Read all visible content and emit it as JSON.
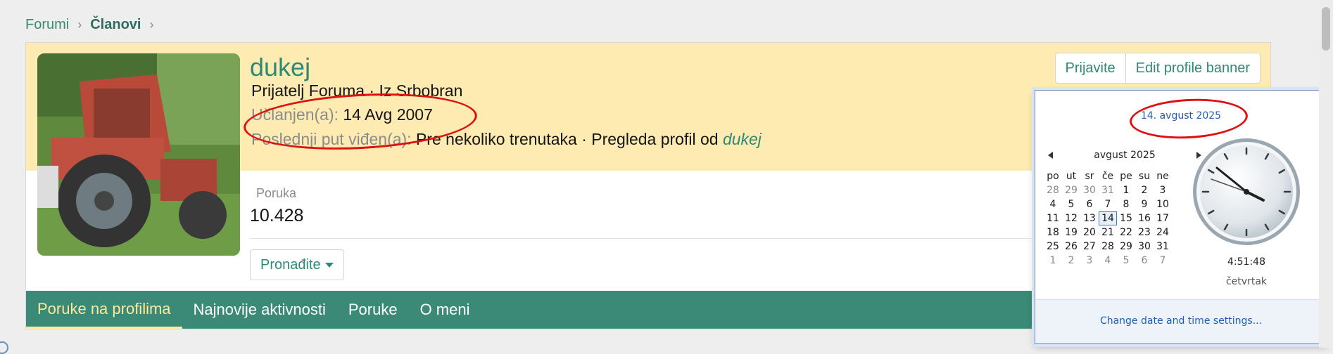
{
  "breadcrumb": {
    "item1": "Forumi",
    "item2": "Članovi"
  },
  "profile": {
    "username": "dukej",
    "title_line": "Prijatelj Foruma · Iz Srbobran",
    "joined_label": "Učlanjen(a):",
    "joined_value": "14 Avg 2007",
    "last_seen_label": "Poslednji put viđen(a):",
    "last_seen_value": "Pre nekoliko trenutaka · Pregleda profil od",
    "last_seen_user": "dukej",
    "stat_label": "Poruka",
    "stat_value": "10.428",
    "find_label": "Pronađite"
  },
  "buttons": {
    "report": "Prijavite",
    "edit_banner": "Edit profile banner"
  },
  "tabs": [
    "Poruke na profilima",
    "Najnovije aktivnosti",
    "Poruke",
    "O meni"
  ],
  "calendar": {
    "date_header": "14. avgust 2025",
    "month_label": "avgust 2025",
    "weekdays": [
      "po",
      "ut",
      "sr",
      "če",
      "pe",
      "su",
      "ne"
    ],
    "days": [
      [
        "28",
        "29",
        "30",
        "31",
        "1",
        "2",
        "3"
      ],
      [
        "4",
        "5",
        "6",
        "7",
        "8",
        "9",
        "10"
      ],
      [
        "11",
        "12",
        "13",
        "14",
        "15",
        "16",
        "17"
      ],
      [
        "18",
        "19",
        "20",
        "21",
        "22",
        "23",
        "24"
      ],
      [
        "25",
        "26",
        "27",
        "28",
        "29",
        "30",
        "31"
      ],
      [
        "1",
        "2",
        "3",
        "4",
        "5",
        "6",
        "7"
      ]
    ],
    "today": "14",
    "time": "4:51:48",
    "day_name": "četvrtak",
    "footer_link": "Change date and time settings..."
  },
  "colors": {
    "accent": "#3a8a77",
    "banner": "#fdebb1",
    "annotation": "#dd1111"
  }
}
